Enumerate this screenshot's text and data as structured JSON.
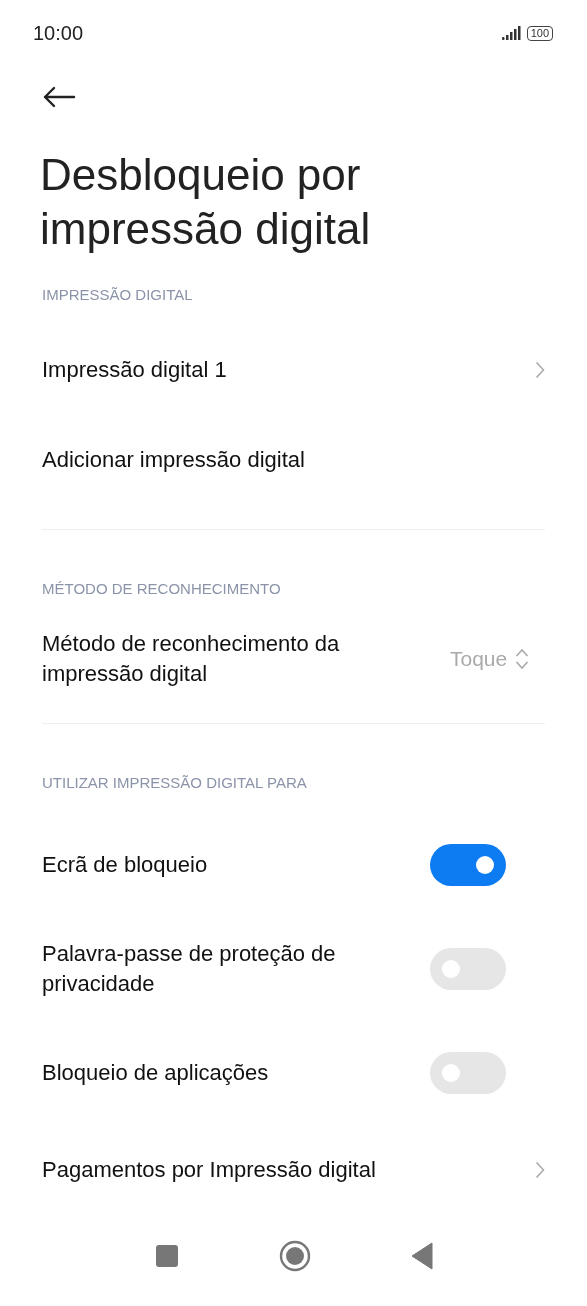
{
  "status_bar": {
    "time": "10:00",
    "battery": "100"
  },
  "title": "Desbloqueio por impressão digital",
  "sections": [
    {
      "header": "IMPRESSÃO DIGITAL",
      "items": [
        {
          "kind": "link",
          "label": "Impressão digital 1"
        },
        {
          "kind": "plain",
          "label": "Adicionar impressão digital"
        }
      ]
    },
    {
      "header": "MÉTODO DE RECONHECIMENTO",
      "items": [
        {
          "kind": "select",
          "label": "Método de reconhecimento da impressão digital",
          "value": "Toque"
        }
      ]
    },
    {
      "header": "UTILIZAR IMPRESSÃO DIGITAL PARA",
      "items": [
        {
          "kind": "toggle",
          "label": "Ecrã de bloqueio",
          "on": true
        },
        {
          "kind": "toggle",
          "label": "Palavra-passe de proteção de privacidade",
          "on": false
        },
        {
          "kind": "toggle",
          "label": "Bloqueio de aplicações",
          "on": false
        },
        {
          "kind": "link",
          "label": "Pagamentos por Impressão digital"
        }
      ]
    }
  ]
}
